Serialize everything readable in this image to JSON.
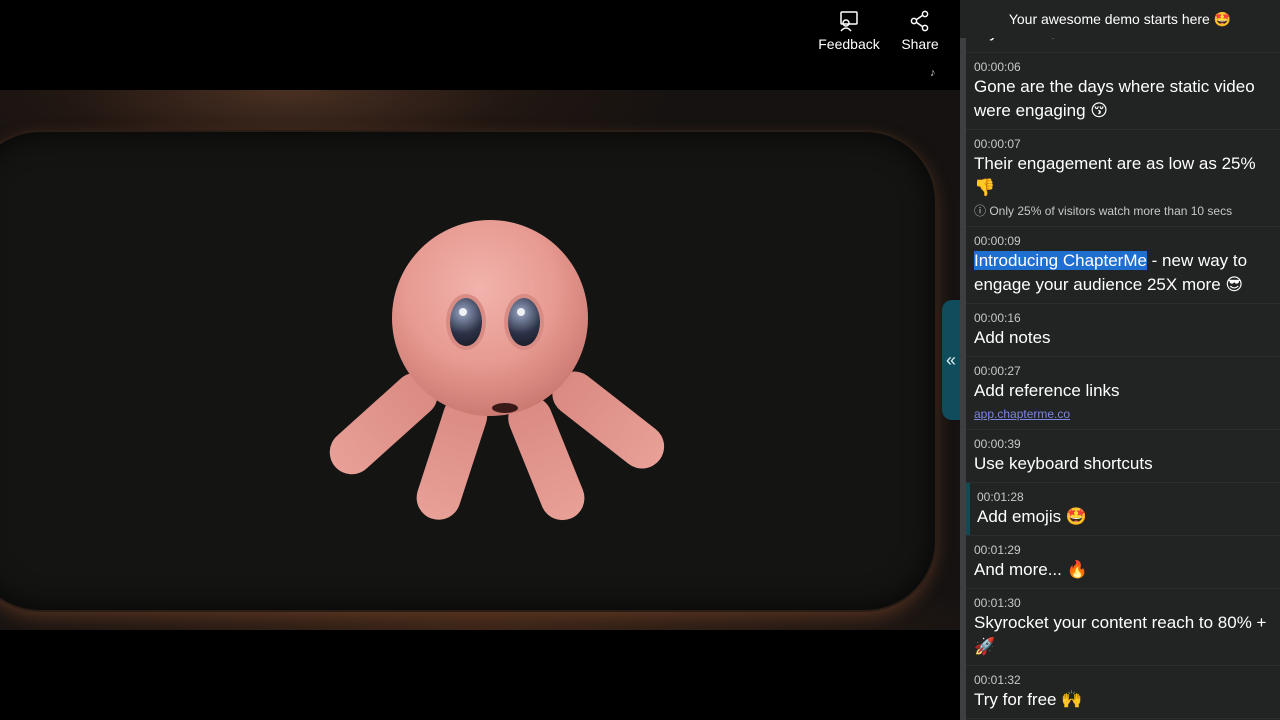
{
  "player": {
    "feedback_label": "Feedback",
    "share_label": "Share",
    "collapse_glyph": "«",
    "note_glyph": "♪"
  },
  "panel": {
    "header": "Your awesome demo starts here 🤩",
    "cut_title": "Try it out 😀",
    "chapters": [
      {
        "time": "00:00:06",
        "title": "Gone are the days where static video were engaging 😚"
      },
      {
        "time": "00:00:07",
        "title": "Their engagement are as low as 25% 👎",
        "note": "ⓘ Only 25% of visitors watch more than 10 secs"
      },
      {
        "time": "00:00:09",
        "title_highlight": "Introducing ChapterMe",
        "title_rest": " - new way to engage your audience 25X more 😎"
      },
      {
        "time": "00:00:16",
        "title": "Add notes"
      },
      {
        "time": "00:00:27",
        "title": "Add reference links",
        "link": "app.chapterme.co"
      },
      {
        "time": "00:00:39",
        "title": "Use keyboard shortcuts"
      },
      {
        "time": "00:01:28",
        "title": "Add emojis 🤩",
        "active": true
      },
      {
        "time": "00:01:29",
        "title": "And more... 🔥"
      },
      {
        "time": "00:01:30",
        "title": "Skyrocket your content reach to 80% + 🚀"
      },
      {
        "time": "00:01:32",
        "title": "Try for free 🙌"
      }
    ]
  },
  "colors": {
    "panel_bg": "#222323",
    "accent_teal": "#114a55",
    "highlight_blue": "#1f6fd1",
    "link": "#7d86e0"
  }
}
